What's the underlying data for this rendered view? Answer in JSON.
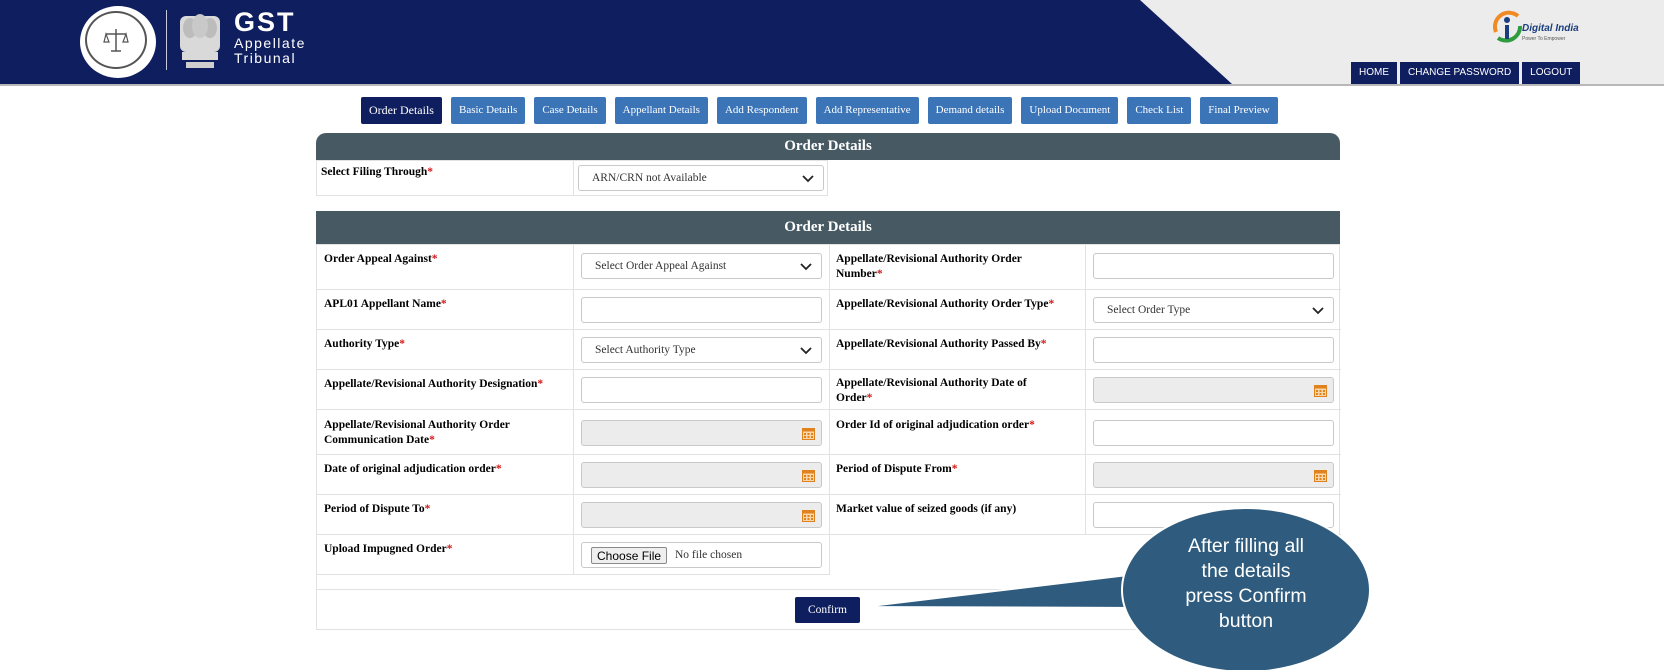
{
  "header": {
    "brand_title": "GST",
    "brand_line1": "Appellate",
    "brand_line2": "Tribunal",
    "seal_text": "GST APPELLATE TRIBUNAL",
    "digital_india": "Digital India",
    "digital_india_tagline": "Power To Empower",
    "nav": [
      {
        "label": "HOME"
      },
      {
        "label": "CHANGE PASSWORD"
      },
      {
        "label": "LOGOUT"
      }
    ]
  },
  "tabs": [
    {
      "label": "Order Details",
      "active": true
    },
    {
      "label": "Basic Details"
    },
    {
      "label": "Case Details"
    },
    {
      "label": "Appellant Details"
    },
    {
      "label": "Add Respondent"
    },
    {
      "label": "Add Representative"
    },
    {
      "label": "Demand details"
    },
    {
      "label": "Upload Document"
    },
    {
      "label": "Check List"
    },
    {
      "label": "Final Preview"
    }
  ],
  "filing_panel": {
    "title": "Order Details",
    "label": "Select Filing Through",
    "value": "ARN/CRN not Available"
  },
  "order_panel": {
    "title": "Order Details",
    "fields": {
      "order_appeal_against": {
        "label": "Order Appeal Against",
        "placeholder": "Select Order Appeal Against"
      },
      "authority_order_number": {
        "label": "Appellate/Revisional Authority Order Number"
      },
      "apl01_appellant_name": {
        "label": "APL01 Appellant Name"
      },
      "authority_order_type": {
        "label": "Appellate/Revisional Authority Order Type",
        "placeholder": "Select Order Type"
      },
      "authority_type": {
        "label": "Authority Type",
        "placeholder": "Select Authority Type"
      },
      "authority_passed_by": {
        "label": "Appellate/Revisional Authority Passed By"
      },
      "authority_designation": {
        "label": "Appellate/Revisional Authority Designation"
      },
      "authority_date_of_order": {
        "label": "Appellate/Revisional Authority Date of Order"
      },
      "authority_order_comm_date": {
        "label": "Appellate/Revisional Authority Order Communication Date"
      },
      "original_order_id": {
        "label": "Order Id of original adjudication order"
      },
      "original_order_date": {
        "label": "Date of original adjudication order"
      },
      "dispute_from": {
        "label": "Period of Dispute From"
      },
      "dispute_to": {
        "label": "Period of Dispute To"
      },
      "market_value": {
        "label": "Market value of seized goods (if any)"
      },
      "upload_impugned": {
        "label": "Upload Impugned Order",
        "button": "Choose File",
        "status": "No file chosen"
      }
    },
    "required_mark": "*",
    "confirm_label": "Confirm"
  },
  "callout": {
    "lines": [
      "After filling all",
      "the details",
      "press Confirm",
      "button"
    ],
    "fill_color": "#2f5c7e"
  },
  "colors": {
    "navy": "#0f1e5e",
    "tab_blue": "#3c74b8",
    "panel_header": "#475a63",
    "required": "#d41a1a"
  }
}
